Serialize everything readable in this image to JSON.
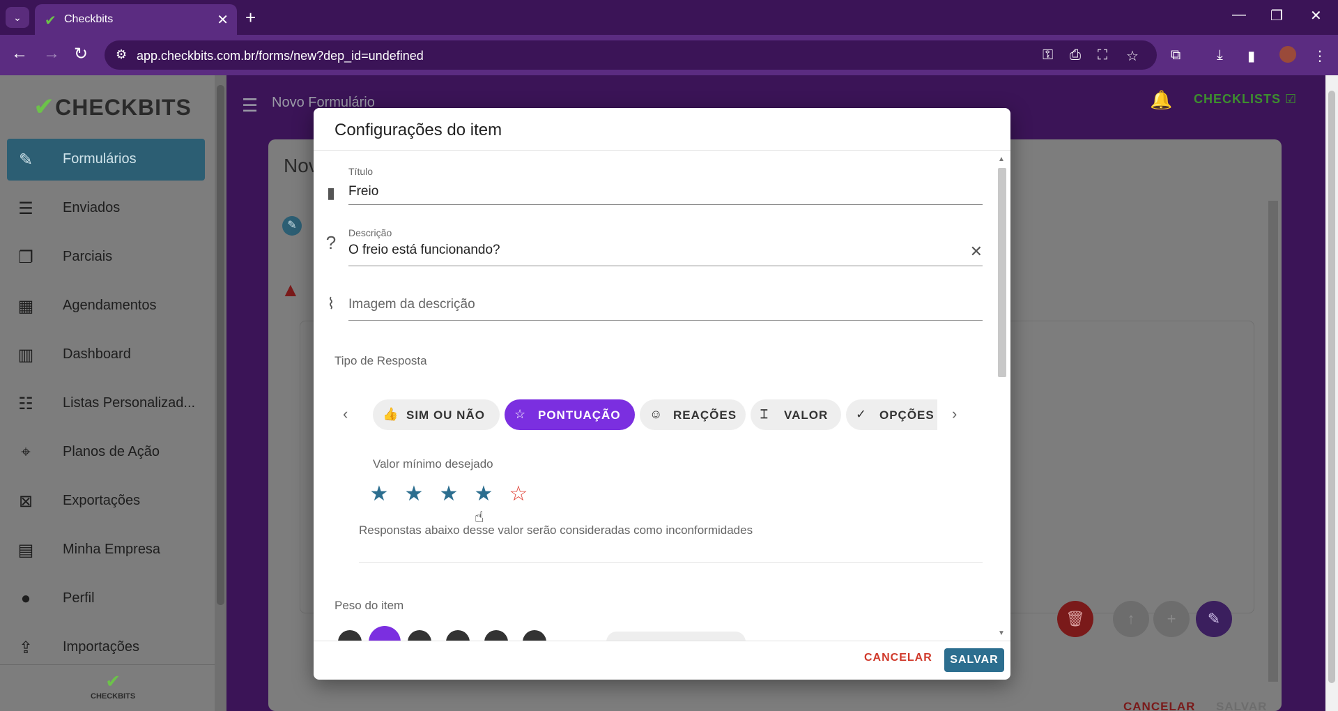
{
  "browser": {
    "tab_title": "Checkbits",
    "url": "app.checkbits.com.br/forms/new?dep_id=undefined"
  },
  "sidebar": {
    "logo": "CHECKBITS",
    "footer_logo": "CHECKBITS",
    "items": [
      {
        "label": "Formulários",
        "icon": "form-edit-icon",
        "active": true
      },
      {
        "label": "Enviados",
        "icon": "sent-list-icon"
      },
      {
        "label": "Parciais",
        "icon": "partial-docs-icon"
      },
      {
        "label": "Agendamentos",
        "icon": "calendar-icon"
      },
      {
        "label": "Dashboard",
        "icon": "bar-chart-icon"
      },
      {
        "label": "Listas Personalizad...",
        "icon": "database-icon"
      },
      {
        "label": "Planos de Ação",
        "icon": "crosshair-icon"
      },
      {
        "label": "Exportações",
        "icon": "excel-icon"
      },
      {
        "label": "Minha Empresa",
        "icon": "building-icon"
      },
      {
        "label": "Perfil",
        "icon": "person-icon"
      },
      {
        "label": "Importações",
        "icon": "import-file-icon"
      }
    ]
  },
  "header": {
    "page_title": "Novo Formulário",
    "checklists": "CHECKLISTS"
  },
  "background_card": {
    "title": "Nov",
    "cancel": "CANCELAR",
    "save": "SALVAR"
  },
  "dialog": {
    "title": "Configurações do item",
    "title_field": {
      "label": "Título",
      "value": "Freio"
    },
    "description_field": {
      "label": "Descrição",
      "value": "O freio está funcionando?"
    },
    "image_field": {
      "placeholder": "Imagem da descrição"
    },
    "response_type_label": "Tipo de Resposta",
    "response_types": [
      {
        "label": "SIM OU NÃO",
        "icon": "thumbs-icon"
      },
      {
        "label": "PONTUAÇÃO",
        "icon": "star-outline-icon",
        "selected": true
      },
      {
        "label": "REAÇÕES",
        "icon": "smile-icon"
      },
      {
        "label": "VALOR",
        "icon": "text-cursor-icon"
      },
      {
        "label": "OPÇÕES",
        "icon": "check-circle-icon"
      }
    ],
    "min_value_label": "Valor mínimo desejado",
    "stars_total": 5,
    "stars_selected": 4,
    "min_value_hint": "Responstas abaixo desse valor serão consideradas como inconformidades",
    "weight_label": "Peso do item",
    "cancel": "CANCELAR",
    "save": "SALVAR"
  },
  "colors": {
    "accent_purple": "#7b2fe0",
    "primary_teal": "#2c6e8f",
    "danger_red": "#d0392b",
    "brand_green": "#6cc24a"
  }
}
